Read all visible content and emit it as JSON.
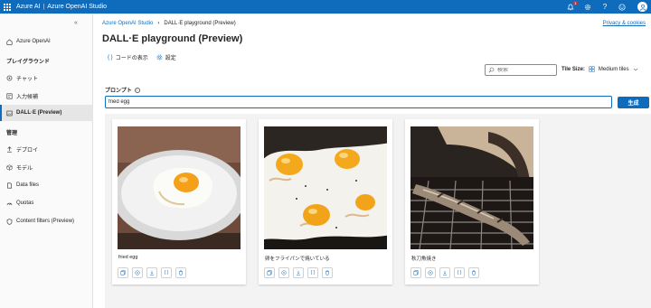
{
  "topbar": {
    "brand": "Azure AI",
    "separator": "|",
    "product": "Azure OpenAI Studio",
    "notification_count": "1"
  },
  "sidebar": {
    "collapse": "«",
    "items": [
      {
        "label": "Azure OpenAI",
        "icon": "home-icon"
      },
      {
        "label": "チャット",
        "icon": "chat-icon"
      },
      {
        "label": "入力候補",
        "icon": "completions-icon"
      },
      {
        "label": "DALL·E (Preview)",
        "icon": "image-icon"
      },
      {
        "label": "デプロイ",
        "icon": "deploy-icon"
      },
      {
        "label": "モデル",
        "icon": "cube-icon"
      },
      {
        "label": "Data files",
        "icon": "file-icon"
      },
      {
        "label": "Quotas",
        "icon": "gauge-icon"
      },
      {
        "label": "Content filters (Preview)",
        "icon": "shield-icon"
      }
    ],
    "headings": {
      "playground": "プレイグラウンド",
      "management": "管理"
    }
  },
  "breadcrumb": {
    "root": "Azure OpenAI Studio",
    "current": "DALL·E playground (Preview)"
  },
  "privacy_link": "Privacy & cookies",
  "page_title": "DALL·E playground (Preview)",
  "toolbar": {
    "view_code": "コードの表示",
    "settings": "設定"
  },
  "search": {
    "placeholder": "検索"
  },
  "tile_size": {
    "label": "Tile Size:",
    "value": "Medium tiles"
  },
  "prompt": {
    "label": "プロンプト",
    "value": "fried egg"
  },
  "generate_button": "生成",
  "cards": [
    {
      "caption": "fried egg",
      "image": "fried-egg-plate"
    },
    {
      "caption": "卵をフライパンで焼いている",
      "image": "eggs-frying-pan"
    },
    {
      "caption": "秋刀魚焼き",
      "image": "grilled-fish"
    }
  ],
  "colors": {
    "accent": "#0f6cbd",
    "topbar": "#0f6cbd",
    "sidebar_bg": "#fafafa",
    "gallery_bg": "#f3f3f3"
  }
}
